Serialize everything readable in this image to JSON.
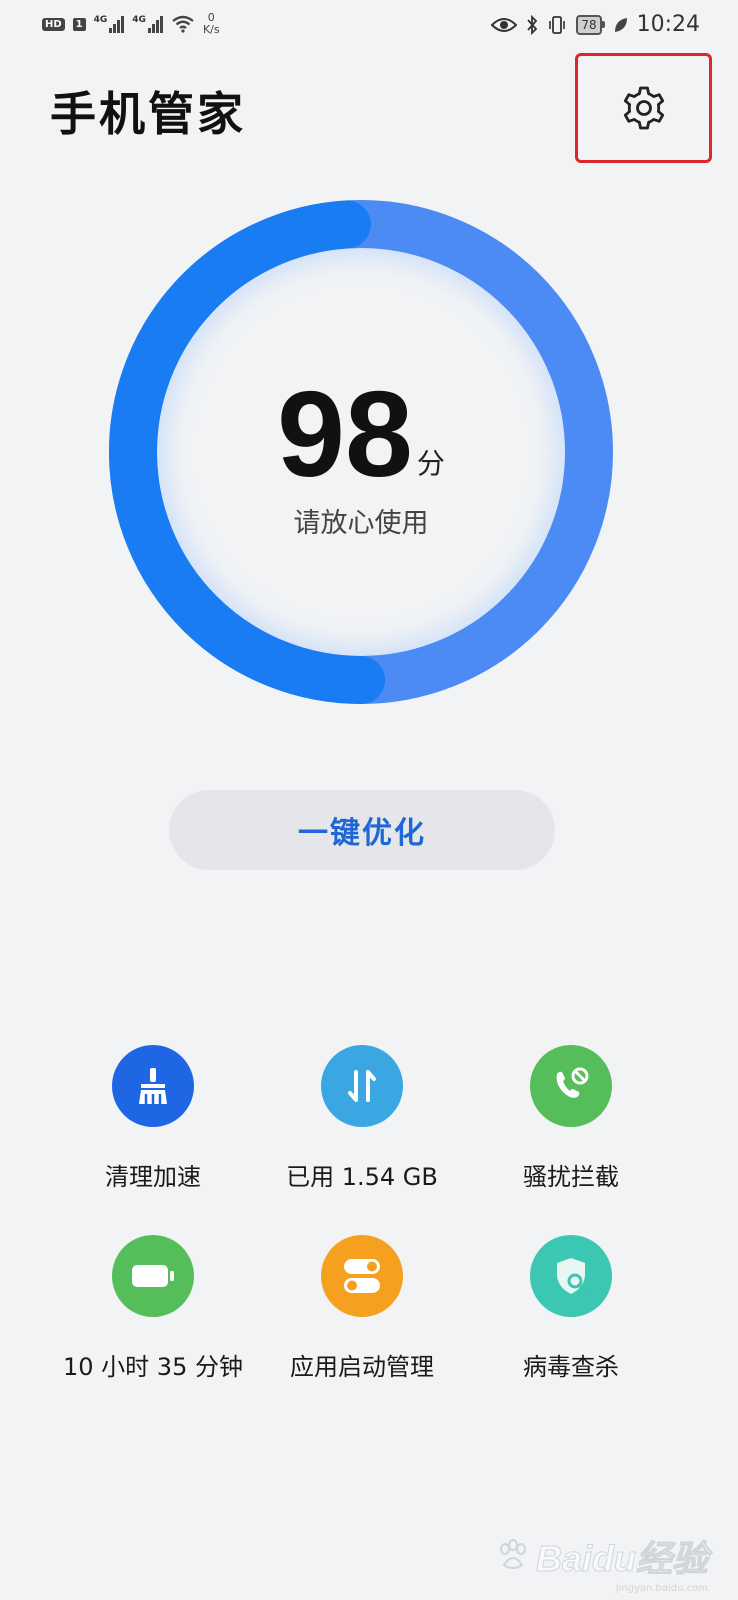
{
  "status_bar": {
    "hd": "HD",
    "sim": "1",
    "net1": "4G",
    "net2": "4G",
    "speed_value": "0",
    "speed_unit": "K/s",
    "battery": "78",
    "time": "10:24"
  },
  "header": {
    "title": "手机管家"
  },
  "score": {
    "value": "98",
    "unit": "分",
    "status": "请放心使用",
    "fraction": 0.98
  },
  "optimize": {
    "label": "一键优化"
  },
  "tools": [
    {
      "label": "清理加速",
      "icon": "broom-icon",
      "color": "#1f66e5"
    },
    {
      "label": "已用 1.54 GB",
      "icon": "data-transfer-icon",
      "color": "#3aa7e2"
    },
    {
      "label": "骚扰拦截",
      "icon": "call-block-icon",
      "color": "#56bd5b"
    },
    {
      "label": "10 小时 35 分钟",
      "icon": "battery-icon",
      "color": "#56bd5b"
    },
    {
      "label": "应用启动管理",
      "icon": "toggle-icon",
      "color": "#f5a11f"
    },
    {
      "label": "病毒查杀",
      "icon": "shield-search-icon",
      "color": "#3cc7b2"
    }
  ],
  "watermark": {
    "text": "Baidu经验",
    "sub": "jingyan.baidu.com"
  }
}
